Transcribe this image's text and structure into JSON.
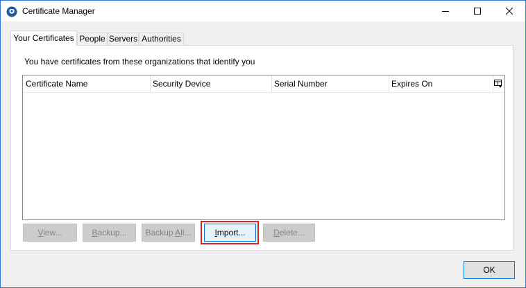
{
  "window": {
    "title": "Certificate Manager",
    "accent_color": "#2b79d7",
    "icons": {
      "app": "certificate-manager-icon",
      "minimize": "minimize-icon",
      "maximize": "maximize-icon",
      "close": "close-icon"
    }
  },
  "tabs": [
    {
      "label": "Your Certificates",
      "active": true
    },
    {
      "label": "People",
      "active": false
    },
    {
      "label": "Servers",
      "active": false
    },
    {
      "label": "Authorities",
      "active": false
    }
  ],
  "panel": {
    "intro": "You have certificates from these organizations that identify you",
    "columns": [
      "Certificate Name",
      "Security Device",
      "Serial Number",
      "Expires On"
    ],
    "column_picker_icon": "column-picker-icon",
    "rows": []
  },
  "buttons": {
    "view": {
      "prefix": "",
      "underline": "V",
      "suffix": "iew...",
      "enabled": false
    },
    "backup": {
      "prefix": "",
      "underline": "B",
      "suffix": "ackup...",
      "enabled": false
    },
    "backup_all": {
      "prefix": "Backup ",
      "underline": "A",
      "suffix": "ll...",
      "enabled": false
    },
    "import": {
      "prefix": "",
      "underline": "I",
      "suffix": "mport...",
      "enabled": true,
      "highlight_color": "#e0202a"
    },
    "delete": {
      "prefix": "",
      "underline": "D",
      "suffix": "elete...",
      "enabled": false
    },
    "ok": "OK"
  }
}
